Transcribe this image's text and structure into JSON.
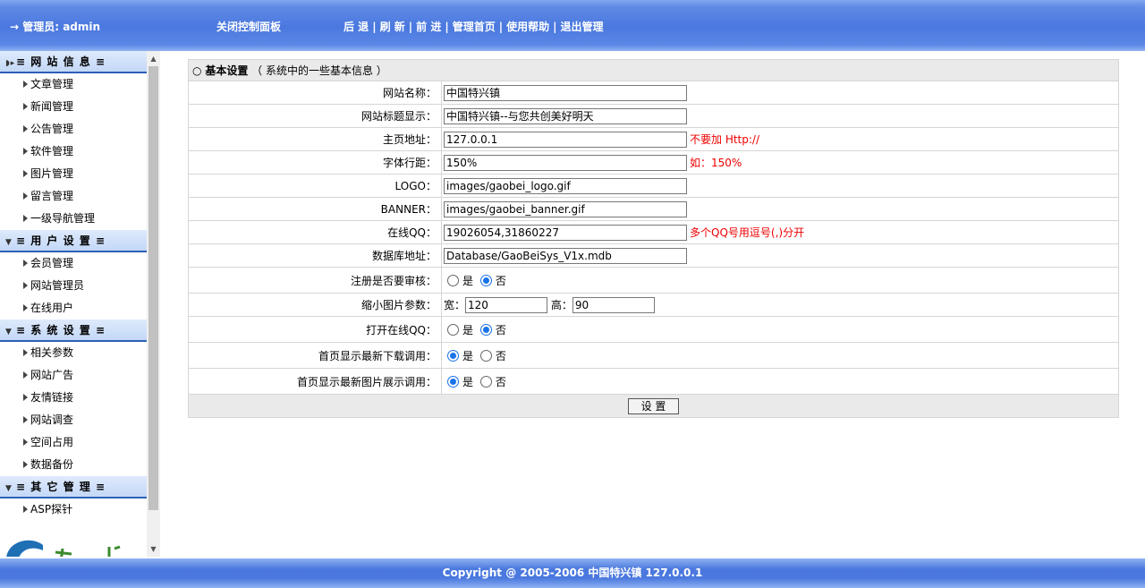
{
  "header": {
    "admin_label": "→ 管理员: admin",
    "close_panel": "关闭控制面板",
    "nav": [
      "后 退",
      "刷 新",
      "前 进",
      "管理首页",
      "使用帮助",
      "退出管理"
    ]
  },
  "sidebar": {
    "sections": [
      {
        "title": "≡ 网 站 信 息 ≡",
        "items": [
          "文章管理",
          "新闻管理",
          "公告管理",
          "软件管理",
          "图片管理",
          "留言管理",
          "一级导航管理"
        ]
      },
      {
        "title": "≡ 用 户 设 置 ≡",
        "items": [
          "会员管理",
          "网站管理员",
          "在线用户"
        ]
      },
      {
        "title": "≡ 系 统 设 置 ≡",
        "items": [
          "相关参数",
          "网站广告",
          "友情链接",
          "网站调查",
          "空间占用",
          "数据备份"
        ]
      },
      {
        "title": "≡ 其 它 管 理 ≡",
        "items": [
          "ASP探针"
        ]
      }
    ]
  },
  "form": {
    "heading_icon": "○",
    "heading": "基本设置",
    "heading_note": "（ 系统中的一些基本信息 ）",
    "site_name_label": "网站名称：",
    "site_name_value": "中国特兴镇",
    "site_title_label": "网站标题显示：",
    "site_title_value": "中国特兴镇--与您共创美好明天",
    "home_url_label": "主页地址：",
    "home_url_value": "127.0.0.1",
    "home_url_hint": "不要加 Http://",
    "line_height_label": "字体行距：",
    "line_height_value": "150%",
    "line_height_hint": "如：150%",
    "logo_label": "LOGO：",
    "logo_value": "images/gaobei_logo.gif",
    "banner_label": "BANNER：",
    "banner_value": "images/gaobei_banner.gif",
    "qq_label": "在线QQ：",
    "qq_value": "19026054,31860227",
    "qq_hint": "多个QQ号用逗号(,)分开",
    "db_label": "数据库地址：",
    "db_value": "Database/GaoBeiSys_V1x.mdb",
    "reg_audit_label": "注册是否要审核：",
    "thumb_label": "缩小图片参数：",
    "thumb_width_label": "宽：",
    "thumb_width_value": "120",
    "thumb_height_label": "高：",
    "thumb_height_value": "90",
    "open_qq_label": "打开在线QQ：",
    "home_download_label": "首页显示最新下载调用：",
    "home_picture_label": "首页显示最新图片展示调用：",
    "yes": "是",
    "no": "否",
    "submit_label": "设 置"
  },
  "footer": {
    "copyright": "Copyright @ 2005-2006 中国特兴镇  127.0.0.1"
  }
}
